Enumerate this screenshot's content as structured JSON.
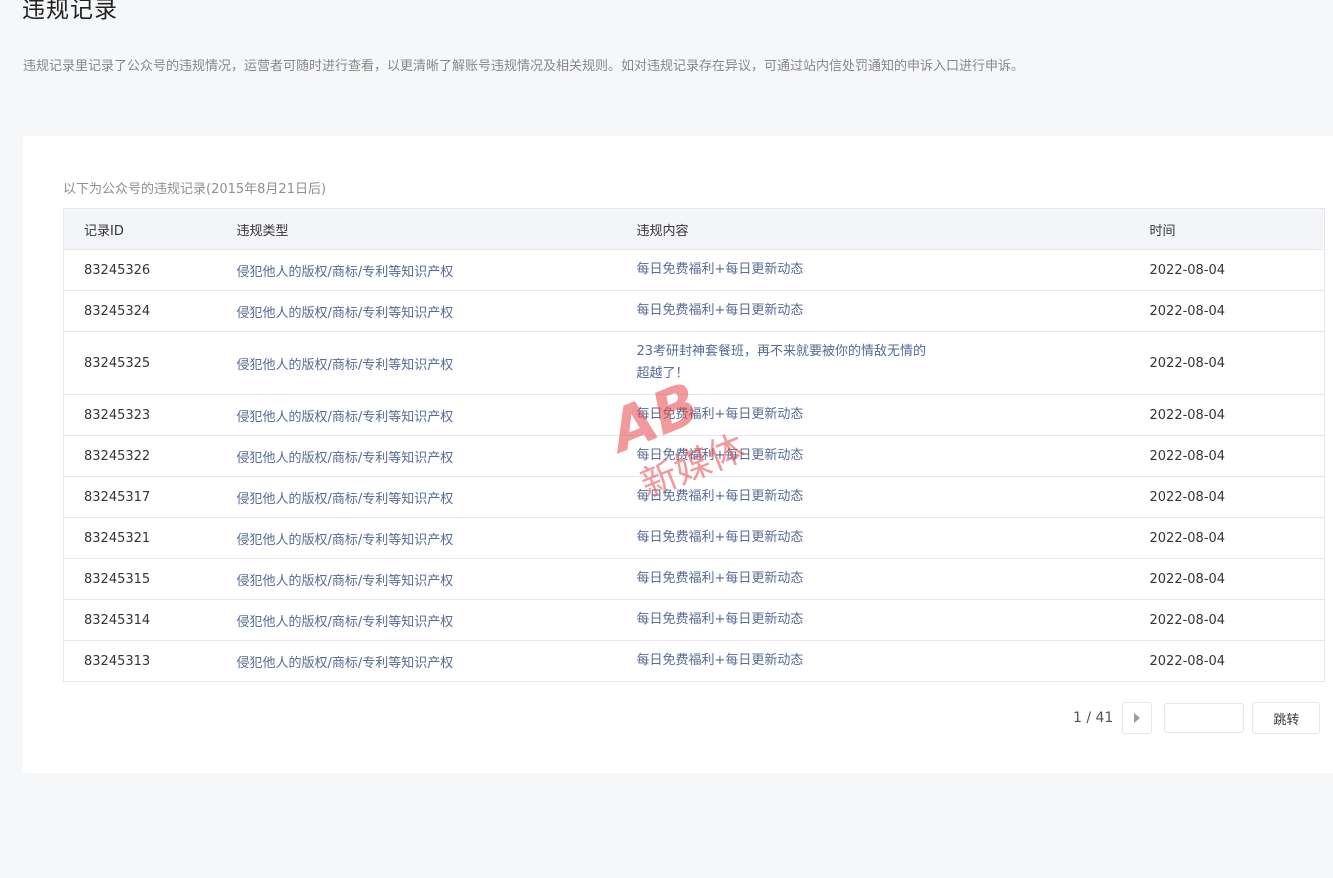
{
  "header": {
    "title": "违规记录",
    "description": "违规记录里记录了公众号的违规情况，运营者可随时进行查看，以更清晰了解账号违规情况及相关规则。如对违规记录存在异议，可通过站内信处罚通知的申诉入口进行申诉。"
  },
  "records": {
    "caption": "以下为公众号的违规记录(2015年8月21日后)",
    "columns": {
      "id": "记录ID",
      "type": "违规类型",
      "content": "违规内容",
      "time": "时间"
    },
    "rows": [
      {
        "id": "83245326",
        "type": "侵犯他人的版权/商标/专利等知识产权",
        "content": "每日免费福利+每日更新动态",
        "time": "2022-08-04"
      },
      {
        "id": "83245324",
        "type": "侵犯他人的版权/商标/专利等知识产权",
        "content": "每日免费福利+每日更新动态",
        "time": "2022-08-04"
      },
      {
        "id": "83245325",
        "type": "侵犯他人的版权/商标/专利等知识产权",
        "content": "23考研封神套餐班，再不来就要被你的情敌无情的超越了！",
        "time": "2022-08-04"
      },
      {
        "id": "83245323",
        "type": "侵犯他人的版权/商标/专利等知识产权",
        "content": "每日免费福利+每日更新动态",
        "time": "2022-08-04"
      },
      {
        "id": "83245322",
        "type": "侵犯他人的版权/商标/专利等知识产权",
        "content": "每日免费福利+每日更新动态",
        "time": "2022-08-04"
      },
      {
        "id": "83245317",
        "type": "侵犯他人的版权/商标/专利等知识产权",
        "content": "每日免费福利+每日更新动态",
        "time": "2022-08-04"
      },
      {
        "id": "83245321",
        "type": "侵犯他人的版权/商标/专利等知识产权",
        "content": "每日免费福利+每日更新动态",
        "time": "2022-08-04"
      },
      {
        "id": "83245315",
        "type": "侵犯他人的版权/商标/专利等知识产权",
        "content": "每日免费福利+每日更新动态",
        "time": "2022-08-04"
      },
      {
        "id": "83245314",
        "type": "侵犯他人的版权/商标/专利等知识产权",
        "content": "每日免费福利+每日更新动态",
        "time": "2022-08-04"
      },
      {
        "id": "83245313",
        "type": "侵犯他人的版权/商标/专利等知识产权",
        "content": "每日免费福利+每日更新动态",
        "time": "2022-08-04"
      }
    ]
  },
  "pagination": {
    "page_info": "1 / 41",
    "next_icon": "triangle-right-icon",
    "jump_input_value": "",
    "jump_label": "跳转"
  },
  "watermark": {
    "text": "新媒体",
    "logo_text": "AB",
    "color": "#e8474c"
  }
}
